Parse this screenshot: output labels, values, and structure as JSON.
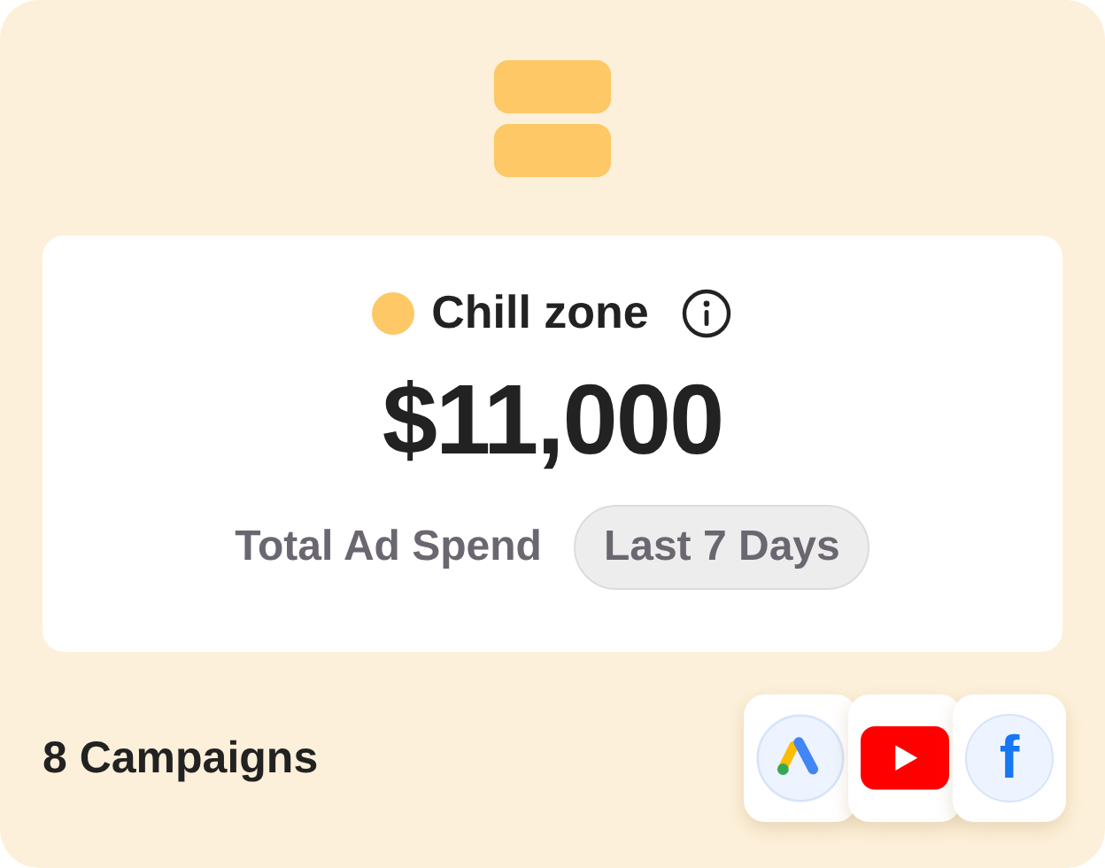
{
  "status": {
    "label": "Chill zone",
    "color": "#fdc865"
  },
  "amount": "$11,000",
  "metric": {
    "label": "Total Ad Spend",
    "period": "Last 7 Days"
  },
  "campaigns": "8 Campaigns",
  "platforms": [
    {
      "kind": "google-ads"
    },
    {
      "kind": "youtube"
    },
    {
      "kind": "facebook",
      "glyph": "f"
    }
  ]
}
